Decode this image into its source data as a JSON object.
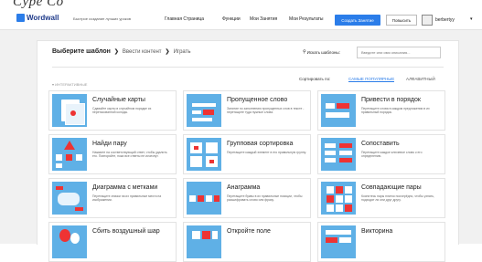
{
  "header": {
    "logo_text": "Wordwall",
    "tagline": "Быстрое создание лучших уроков",
    "nav": [
      "Главная Страница",
      "Функции",
      "Мои Занятия",
      "Мои Результаты"
    ],
    "signup_label": "Создать Занятие",
    "upgrade_label": "Повысить",
    "user_name": "berbertyy",
    "user_caret": "▾",
    "brand_peek": "Cype Со"
  },
  "breadcrumb": {
    "step1": "Выберите шаблон",
    "step2": "Ввести контент",
    "step3": "Играть",
    "separator": "❯"
  },
  "search": {
    "label": "Искать шаблоны:",
    "placeholder": "Введите или имя описания..."
  },
  "sort": {
    "label": "Сортировать по:",
    "popular": "САМЫЕ ПОПУЛЯРНЫЕ",
    "alpha": "АЛФАВИТНЫЙ"
  },
  "section": {
    "label": "▾ ИНТЕРАКТИВНЫЕ"
  },
  "templates": [
    {
      "title": "Случайные карты",
      "desc": "Сдавайте карты в случайном порядке из перетасованной колоды.",
      "icon": "cards-icon"
    },
    {
      "title": "Пропущенное слово",
      "desc": "Занятие по заполнению пропущенных слов в тексте - перетащите туда нужные слова.",
      "icon": "missing-word-icon"
    },
    {
      "title": "Привести в порядок",
      "desc": "Перетащите слова в каждом предложении в их правильный порядок.",
      "icon": "order-icon"
    },
    {
      "title": "Найди пару",
      "desc": "Нажмите на соответствующий ответ, чтобы удалить его. Повторяйте, пока все ответы не исчезнут.",
      "icon": "find-match-icon"
    },
    {
      "title": "Групповая сортировка",
      "desc": "Перетащите каждый элемент в его правильную группу.",
      "icon": "group-sort-icon"
    },
    {
      "title": "Сопоставить",
      "desc": "Перетащите каждое ключевое слово к его определению.",
      "icon": "match-up-icon"
    },
    {
      "title": "Диаграмма с метками",
      "desc": "Перетащите значки на их правильные места на изображении.",
      "icon": "labelled-diagram-icon"
    },
    {
      "title": "Анаграмма",
      "desc": "Перетащите буквы в их правильные позиции, чтобы расшифровать слово или фразу.",
      "icon": "anagram-icon"
    },
    {
      "title": "Совпадающие пары",
      "desc": "Коснитесь пары плиток поочерёдно, чтобы узнать, подходят ли они друг другу.",
      "icon": "matching-pairs-icon"
    },
    {
      "title": "Сбить воздушный шар",
      "desc": "",
      "icon": "balloon-icon"
    },
    {
      "title": "Откройте поле",
      "desc": "",
      "icon": "open-box-icon"
    },
    {
      "title": "Викторина",
      "desc": "",
      "icon": "quiz-icon"
    }
  ]
}
